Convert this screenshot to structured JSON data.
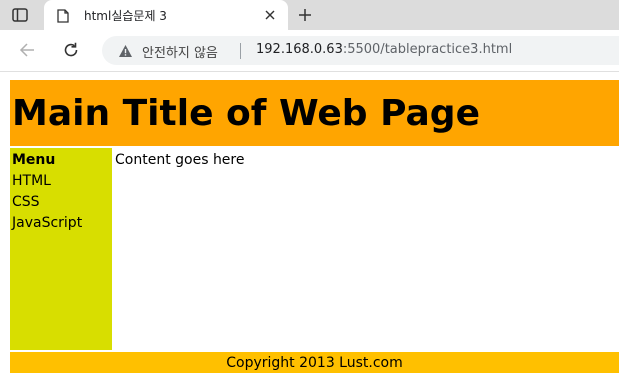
{
  "browser": {
    "tab": {
      "title": "html실습문제 3",
      "close_icon": "close-icon",
      "favicon": "document-icon"
    },
    "new_tab_icon": "plus-icon",
    "tab_actions_icon": "tab-actions-icon",
    "back_icon": "arrow-left-icon",
    "reload_icon": "reload-icon",
    "address": {
      "security_icon": "warning-triangle-icon",
      "security_label": "안전하지 않음",
      "url_host": "192.168.0.63",
      "url_rest": ":5500/tablepractice3.html"
    }
  },
  "page": {
    "title": "Main Title of Web Page",
    "menu": {
      "heading": "Menu",
      "items": [
        "HTML",
        "CSS",
        "JavaScript"
      ]
    },
    "content": "Content goes here",
    "footer": "Copyright 2013 Lust.com"
  },
  "colors": {
    "header_bg": "#ffa500",
    "sidebar_bg": "#d8de00",
    "footer_bg": "#ffc000",
    "tabbar_bg": "#dcdcdc"
  }
}
